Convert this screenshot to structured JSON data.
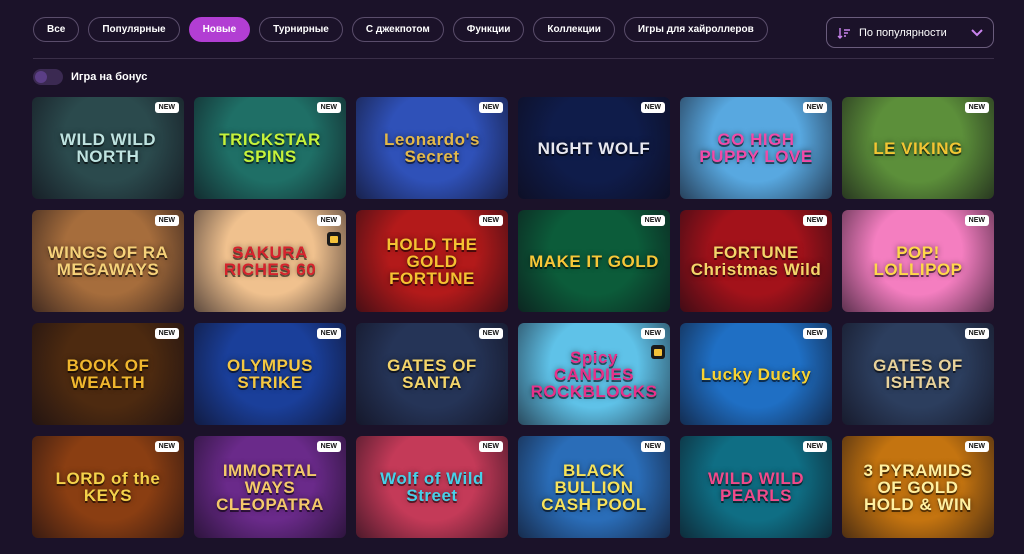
{
  "filters": [
    {
      "label": "Все",
      "active": false
    },
    {
      "label": "Популярные",
      "active": false
    },
    {
      "label": "Новые",
      "active": true
    },
    {
      "label": "Турнирные",
      "active": false
    },
    {
      "label": "С джекпотом",
      "active": false
    },
    {
      "label": "Функции",
      "active": false
    },
    {
      "label": "Коллекции",
      "active": false
    },
    {
      "label": "Игры для хайроллеров",
      "active": false
    }
  ],
  "sort": {
    "label": "По популярности",
    "icon": "sort-desc-icon"
  },
  "bonus_toggle": {
    "label": "Игра на бонус",
    "on": false
  },
  "badge_new": "NEW",
  "games": [
    {
      "title": "WILD WILD NORTH",
      "bg": "#2b4a4d",
      "accent": "#bfe3e0",
      "gift": false
    },
    {
      "title": "TRICKSTAR SPINS",
      "bg": "#1f6f66",
      "accent": "#c6f23a",
      "gift": false
    },
    {
      "title": "Leonardo's Secret",
      "bg": "#2f51b8",
      "accent": "#e3b84a",
      "gift": false
    },
    {
      "title": "NIGHT WOLF",
      "bg": "#0f1c4a",
      "accent": "#e8e8f0",
      "gift": false
    },
    {
      "title": "GO HIGH PUPPY LOVE",
      "bg": "#58a8e0",
      "accent": "#f04aa8",
      "gift": false
    },
    {
      "title": "LE VIKING",
      "bg": "#5c8f3a",
      "accent": "#f2c533",
      "gift": false
    },
    {
      "title": "WINGS OF RA MEGAWAYS",
      "bg": "#a66d3c",
      "accent": "#f6d27a",
      "gift": false
    },
    {
      "title": "SAKURA RICHES 60",
      "bg": "#f0c18e",
      "accent": "#d6232d",
      "gift": true
    },
    {
      "title": "HOLD THE GOLD FORTUNE",
      "bg": "#b31a1a",
      "accent": "#f5c232",
      "gift": false
    },
    {
      "title": "MAKE IT GOLD",
      "bg": "#0c5c3a",
      "accent": "#f7c738",
      "gift": false
    },
    {
      "title": "FORTUNE Christmas Wild",
      "bg": "#a3121a",
      "accent": "#f4d56a",
      "gift": false
    },
    {
      "title": "POP! LOLLIPOP",
      "bg": "#f47ec0",
      "accent": "#ffd84a",
      "gift": false
    },
    {
      "title": "BOOK OF WEALTH",
      "bg": "#4d2a10",
      "accent": "#f0b72e",
      "gift": false
    },
    {
      "title": "OLYMPUS STRIKE",
      "bg": "#1a3f9a",
      "accent": "#f4c742",
      "gift": false
    },
    {
      "title": "GATES OF SANTA",
      "bg": "#253457",
      "accent": "#f4d56a",
      "gift": false
    },
    {
      "title": "Spicy CANDIES ROCKBLOCKS",
      "bg": "#5fc2e8",
      "accent": "#e8308a",
      "gift": true
    },
    {
      "title": "Lucky Ducky",
      "bg": "#1f6fc4",
      "accent": "#f7d232",
      "gift": false
    },
    {
      "title": "GATES OF ISHTAR",
      "bg": "#2c3e5e",
      "accent": "#e8d29a",
      "gift": false
    },
    {
      "title": "LORD of the KEYS",
      "bg": "#8a3e12",
      "accent": "#f4d24a",
      "gift": false
    },
    {
      "title": "IMMORTAL WAYS CLEOPATRA",
      "bg": "#6a2a8a",
      "accent": "#f4c96a",
      "gift": false
    },
    {
      "title": "Wolf of Wild Street",
      "bg": "#c43a58",
      "accent": "#46d0e8",
      "gift": false
    },
    {
      "title": "BLACK BULLION CASH POOL",
      "bg": "#2a6db8",
      "accent": "#f7e25a",
      "gift": false
    },
    {
      "title": "WILD WILD PEARLS",
      "bg": "#0f6e84",
      "accent": "#f04a8a",
      "gift": false
    },
    {
      "title": "3 PYRAMIDS OF GOLD HOLD & WIN",
      "bg": "#c47410",
      "accent": "#fff0a0",
      "gift": false
    }
  ]
}
